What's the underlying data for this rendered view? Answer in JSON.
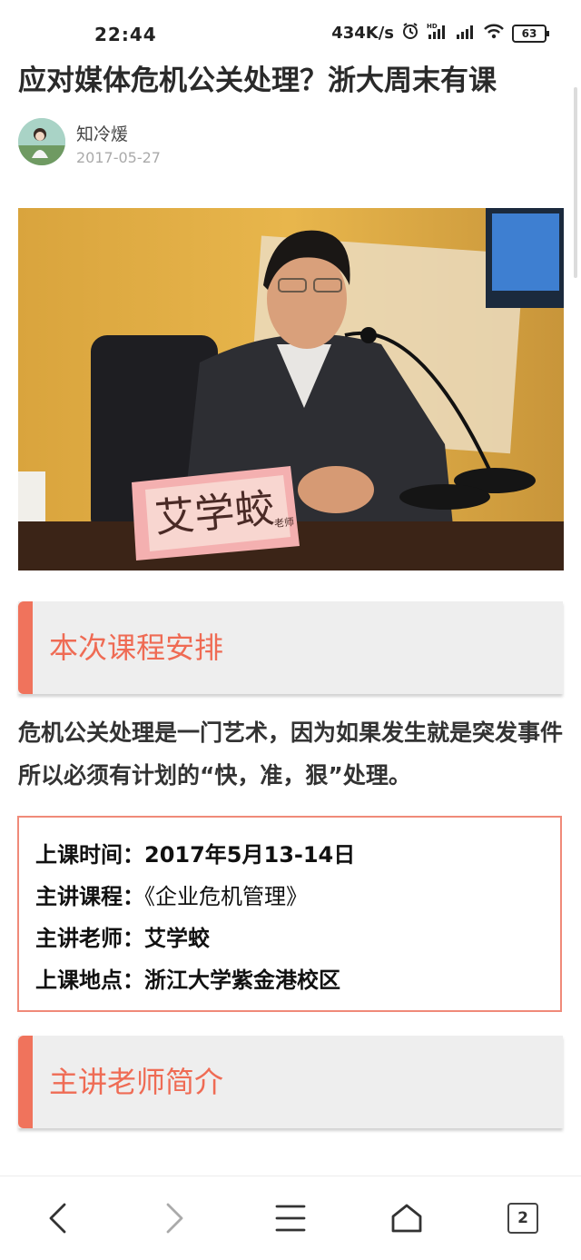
{
  "status_bar": {
    "time": "22:44",
    "network_speed": "434K/s",
    "battery": "63",
    "icons": [
      "alarm-icon",
      "hd-signal-icon",
      "signal-icon",
      "wifi-icon",
      "battery-icon"
    ]
  },
  "article": {
    "title": "应对媒体危机公关处理？浙大周末有课",
    "author": "知冷煖",
    "date": "2017-05-27",
    "photo_nameplate": "艾学蛟",
    "photo_nameplate_suffix": "老师"
  },
  "section1": {
    "heading": "本次课程安排"
  },
  "intro_text": "危机公关处理是一门艺术，因为如果发生就是突发事件所以必须有计划的“快，准，狠”处理。",
  "course_info": {
    "time_label": "上课时间：",
    "time_value": "2017年5月13-14日",
    "course_label": "主讲课程：",
    "course_value": "《企业危机管理》",
    "teacher_label": "主讲老师：",
    "teacher_value": "艾学蛟",
    "location_label": "上课地点：",
    "location_value": "浙江大学紫金港校区"
  },
  "section2": {
    "heading": "主讲老师简介"
  },
  "bottom_nav": {
    "tab_count": "2",
    "icons": [
      "back-icon",
      "forward-icon",
      "menu-icon",
      "home-icon",
      "tabs-icon"
    ]
  },
  "colors": {
    "accent": "#ef6b54",
    "section_bg": "#eeeeee",
    "box_border": "#f08a79"
  }
}
